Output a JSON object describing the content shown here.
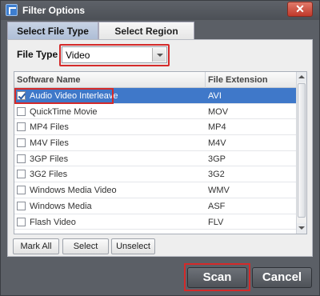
{
  "window": {
    "title": "Filter Options",
    "close_glyph": "✕"
  },
  "tabs": [
    {
      "label": "Select File Type"
    },
    {
      "label": "Select Region"
    }
  ],
  "file_type": {
    "label": "File Type",
    "value": "Video"
  },
  "table": {
    "columns": [
      "Software Name",
      "File Extension"
    ],
    "rows": [
      {
        "name": "Audio Video Interleave",
        "ext": "AVI",
        "checked": true
      },
      {
        "name": "QuickTime Movie",
        "ext": "MOV",
        "checked": false
      },
      {
        "name": "MP4 Files",
        "ext": "MP4",
        "checked": false
      },
      {
        "name": "M4V Files",
        "ext": "M4V",
        "checked": false
      },
      {
        "name": "3GP Files",
        "ext": "3GP",
        "checked": false
      },
      {
        "name": "3G2 Files",
        "ext": "3G2",
        "checked": false
      },
      {
        "name": "Windows Media Video",
        "ext": "WMV",
        "checked": false
      },
      {
        "name": "Windows Media",
        "ext": "ASF",
        "checked": false
      },
      {
        "name": "Flash Video",
        "ext": "FLV",
        "checked": false
      }
    ]
  },
  "buttons": {
    "mark_all": "Mark All",
    "select": "Select",
    "unselect": "Unselect",
    "scan": "Scan",
    "cancel": "Cancel"
  },
  "colors": {
    "highlight": "#d42a2a",
    "selection": "#3f78c9"
  }
}
